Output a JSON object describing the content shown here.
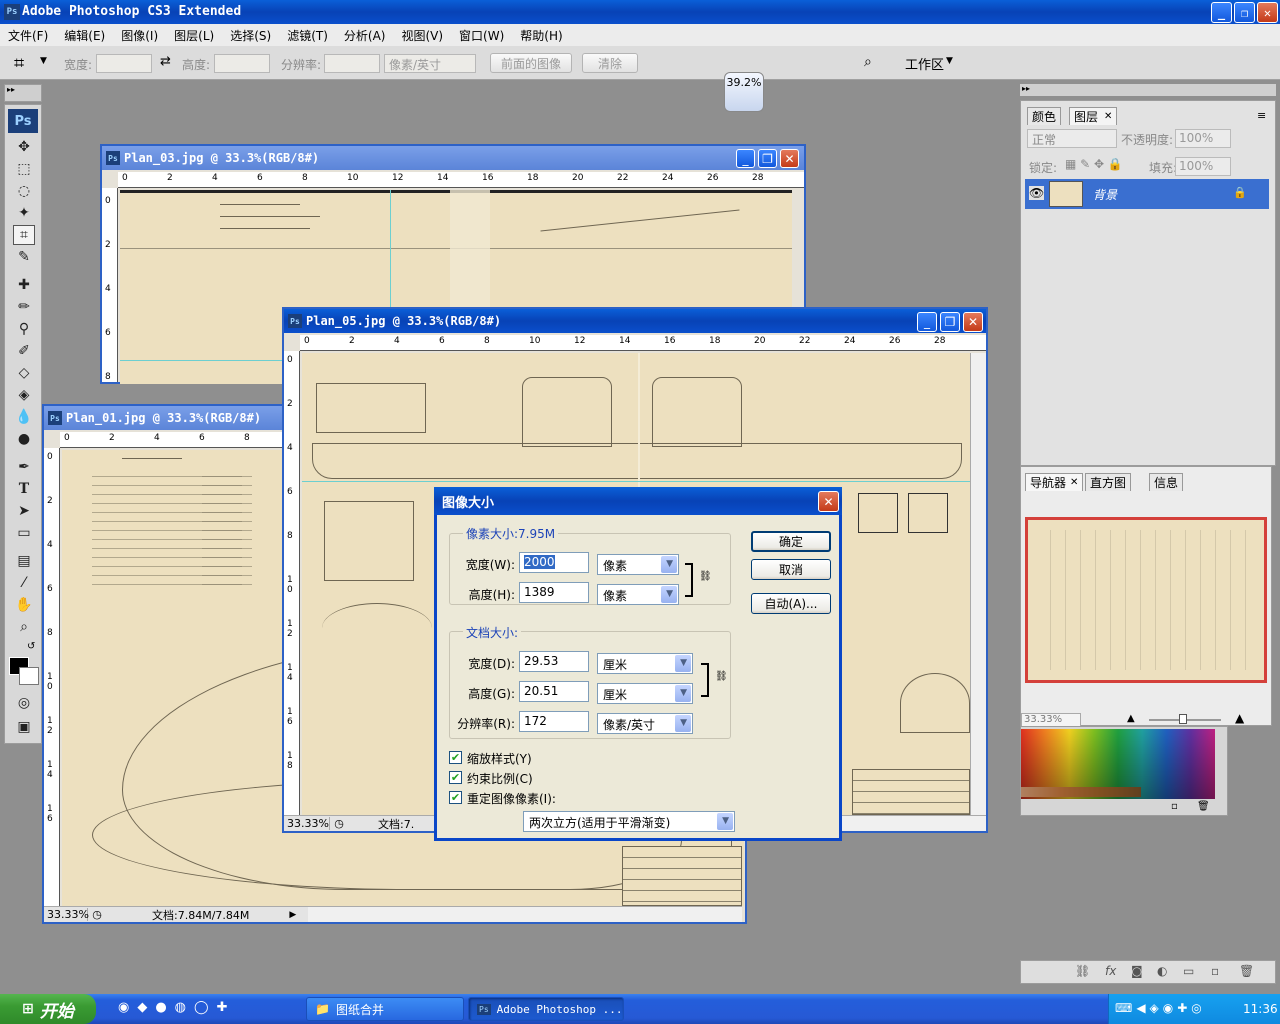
{
  "app": {
    "title": "Adobe Photoshop CS3 Extended",
    "logo": "Ps"
  },
  "menu": [
    "文件(F)",
    "编辑(E)",
    "图像(I)",
    "图层(L)",
    "选择(S)",
    "滤镜(T)",
    "分析(A)",
    "视图(V)",
    "窗口(W)",
    "帮助(H)"
  ],
  "options": {
    "width_label": "宽度:",
    "height_label": "高度:",
    "resolution_label": "分辨率:",
    "unit": "像素/英寸",
    "front_image": "前面的图像",
    "clear": "清除",
    "workspace": "工作区",
    "zoom_badge": "39.2%"
  },
  "documents": {
    "plan03": {
      "title": "Plan_03.jpg @ 33.3%(RGB/8#)"
    },
    "plan05": {
      "title": "Plan_05.jpg @ 33.3%(RGB/8#)",
      "zoom": "33.33%",
      "doc": "文档:7."
    },
    "plan01": {
      "title": "Plan_01.jpg @ 33.3%(RGB/8#)",
      "zoom": "33.33%",
      "doc": "文档:7.84M/7.84M"
    }
  },
  "ruler_h_plan03": [
    "0",
    "2",
    "4",
    "6",
    "8",
    "10",
    "12",
    "14",
    "16",
    "18",
    "20",
    "22",
    "24",
    "26",
    "28"
  ],
  "ruler_h_plan05": [
    "0",
    "2",
    "4",
    "6",
    "8",
    "10",
    "12",
    "14",
    "16",
    "18",
    "20",
    "22",
    "24",
    "26",
    "28"
  ],
  "ruler_h_plan01": [
    "0",
    "2",
    "4",
    "6",
    "8"
  ],
  "ruler_v_plan03": [
    "0",
    "2",
    "4",
    "6",
    "8"
  ],
  "ruler_v_plan05": [
    "0",
    "2",
    "4",
    "6",
    "8",
    "1 0",
    "1 2",
    "1 4",
    "1 6",
    "1 8"
  ],
  "ruler_v_plan01": [
    "0",
    "2",
    "4",
    "6",
    "8",
    "1 0",
    "1 2",
    "1 4",
    "1 6"
  ],
  "dialog": {
    "title": "图像大小",
    "pixel_group": "像素大小:7.95M",
    "width_label": "宽度(W):",
    "width_value": "2000",
    "width_unit": "像素",
    "height_label": "高度(H):",
    "height_value": "1389",
    "height_unit": "像素",
    "doc_group": "文档大小:",
    "doc_width_label": "宽度(D):",
    "doc_width_value": "29.53",
    "doc_width_unit": "厘米",
    "doc_height_label": "高度(G):",
    "doc_height_value": "20.51",
    "doc_height_unit": "厘米",
    "res_label": "分辨率(R):",
    "res_value": "172",
    "res_unit": "像素/英寸",
    "scale_styles": "缩放样式(Y)",
    "constrain": "约束比例(C)",
    "resample": "重定图像像素(I):",
    "method": "两次立方(适用于平滑渐变)",
    "ok": "确定",
    "cancel": "取消",
    "auto": "自动(A)..."
  },
  "layers_panel": {
    "tabs": [
      "颜色",
      "图层"
    ],
    "blend_mode": "正常",
    "opacity_label": "不透明度:",
    "opacity_value": "100%",
    "lock_label": "锁定:",
    "fill_label": "填充:",
    "fill_value": "100%",
    "layer_name": "背景"
  },
  "navigator_panel": {
    "tabs": [
      "导航器",
      "直方图",
      "信息"
    ],
    "zoom": "33.33%"
  },
  "taskbar": {
    "start": "开始",
    "tasks": [
      "图纸合并",
      "Adobe Photoshop ..."
    ],
    "clock": "11:36"
  },
  "colors": {
    "xp_blue": "#0842b6",
    "selected_layer": "#3a6fd0",
    "paper": "#ede0bf"
  }
}
